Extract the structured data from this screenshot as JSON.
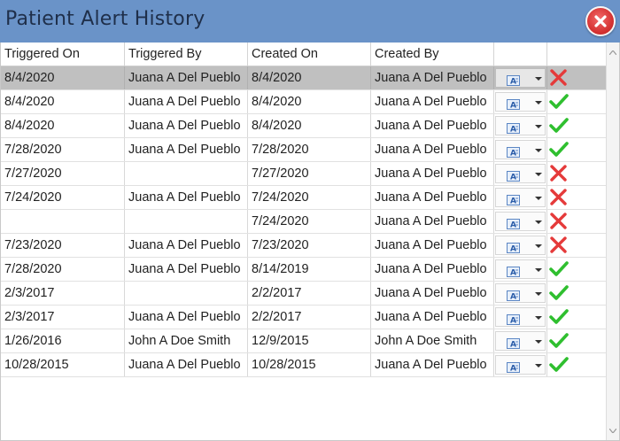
{
  "window": {
    "title": "Patient Alert History",
    "close_icon": "close-icon"
  },
  "columns": [
    "Triggered On",
    "Triggered By",
    "Created On",
    "Created By",
    "",
    ""
  ],
  "rows": [
    {
      "triggered_on": "8/4/2020",
      "triggered_by": "Juana A Del Pueblo",
      "created_on": "8/4/2020",
      "created_by": "Juana A Del Pueblo",
      "status": "x"
    },
    {
      "triggered_on": "8/4/2020",
      "triggered_by": "Juana A Del Pueblo",
      "created_on": "8/4/2020",
      "created_by": "Juana A Del Pueblo",
      "status": "check"
    },
    {
      "triggered_on": "8/4/2020",
      "triggered_by": "Juana A Del Pueblo",
      "created_on": "8/4/2020",
      "created_by": "Juana A Del Pueblo",
      "status": "check"
    },
    {
      "triggered_on": "7/28/2020",
      "triggered_by": "Juana A Del Pueblo",
      "created_on": "7/28/2020",
      "created_by": "Juana A Del Pueblo",
      "status": "check"
    },
    {
      "triggered_on": "7/27/2020",
      "triggered_by": "",
      "created_on": "7/27/2020",
      "created_by": "Juana A Del Pueblo",
      "status": "x"
    },
    {
      "triggered_on": "7/24/2020",
      "triggered_by": "Juana A Del Pueblo",
      "created_on": "7/24/2020",
      "created_by": "Juana A Del Pueblo",
      "status": "x"
    },
    {
      "triggered_on": "",
      "triggered_by": "",
      "created_on": "7/24/2020",
      "created_by": "Juana A Del Pueblo",
      "status": "x"
    },
    {
      "triggered_on": "7/23/2020",
      "triggered_by": "Juana A Del Pueblo",
      "created_on": "7/23/2020",
      "created_by": "Juana A Del Pueblo",
      "status": "x"
    },
    {
      "triggered_on": "7/28/2020",
      "triggered_by": "Juana A Del Pueblo",
      "created_on": "8/14/2019",
      "created_by": "Juana A Del Pueblo",
      "status": "check"
    },
    {
      "triggered_on": "2/3/2017",
      "triggered_by": "",
      "created_on": "2/2/2017",
      "created_by": "Juana A Del Pueblo",
      "status": "check"
    },
    {
      "triggered_on": "2/3/2017",
      "triggered_by": "Juana A Del Pueblo",
      "created_on": "2/2/2017",
      "created_by": "Juana A Del Pueblo",
      "status": "check"
    },
    {
      "triggered_on": "1/26/2016",
      "triggered_by": "John A Doe Smith",
      "created_on": "12/9/2015",
      "created_by": "John A Doe Smith",
      "status": "check"
    },
    {
      "triggered_on": "10/28/2015",
      "triggered_by": "Juana A Del Pueblo",
      "created_on": "10/28/2015",
      "created_by": "Juana A Del Pueblo",
      "status": "check"
    }
  ],
  "selected_row": 0,
  "colors": {
    "titlebar": "#6a93c8",
    "selected_row": "#c0c0c0",
    "check": "#2fbf2f",
    "x": "#e53a3a",
    "close": "#d63434"
  }
}
